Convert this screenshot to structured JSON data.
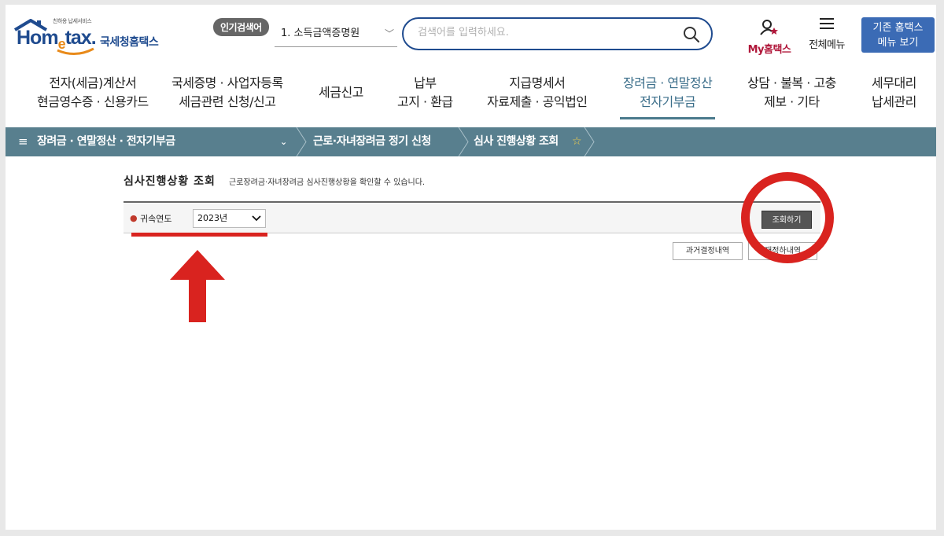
{
  "logo": {
    "tagline": "친하옹 납세서비스",
    "word_pre": "Hom",
    "word_e": "e",
    "word_post": "tax.",
    "name": "국세청홈택스"
  },
  "header": {
    "popular_badge": "인기검색어",
    "popular_selected": "1. 소득금액증명원",
    "search_placeholder": "검색어를 입력하세요.",
    "my_label": "My홈택스",
    "allmenu_label": "전체메뉴",
    "old_home_line1": "기존 홈택스",
    "old_home_line2": "메뉴 보기"
  },
  "gnb": {
    "items": [
      {
        "line1": "전자(세금)계산서",
        "line2": "현금영수증 · 신용카드"
      },
      {
        "line1": "국세증명 · 사업자등록",
        "line2": "세금관련 신청/신고"
      },
      {
        "line1": "세금신고",
        "line2": ""
      },
      {
        "line1": "납부",
        "line2": "고지 · 환급"
      },
      {
        "line1": "지급명세서",
        "line2": "자료제출 · 공익법인"
      },
      {
        "line1": "장려금 · 연말정산",
        "line2": "전자기부금"
      },
      {
        "line1": "상담 · 불복 · 고충",
        "line2": "제보 · 기타"
      },
      {
        "line1": "세무대리",
        "line2": "납세관리"
      }
    ],
    "active_index": 5
  },
  "breadcrumb": {
    "menu_icon": "≡",
    "level1": "장려금 · 연말정산 · 전자기부금",
    "level2": "근로·자녀장려금 정기 신청",
    "level3": "심사 진행상황 조회",
    "favorite_icon": "☆"
  },
  "content": {
    "title": "심사진행상황 조회",
    "description": "근로장려금·자녀장려금 심사진행상황을 확인할 수 있습니다.",
    "year_label": "귀속연도",
    "year_value": "2023년",
    "search_button": "조회하기",
    "past_button": "과거결정내역",
    "second_button": "재정하내역"
  },
  "colors": {
    "brand_blue": "#1f4b8f",
    "breadcrumb_bg": "#587f8e",
    "annotation_red": "#d9231f"
  }
}
